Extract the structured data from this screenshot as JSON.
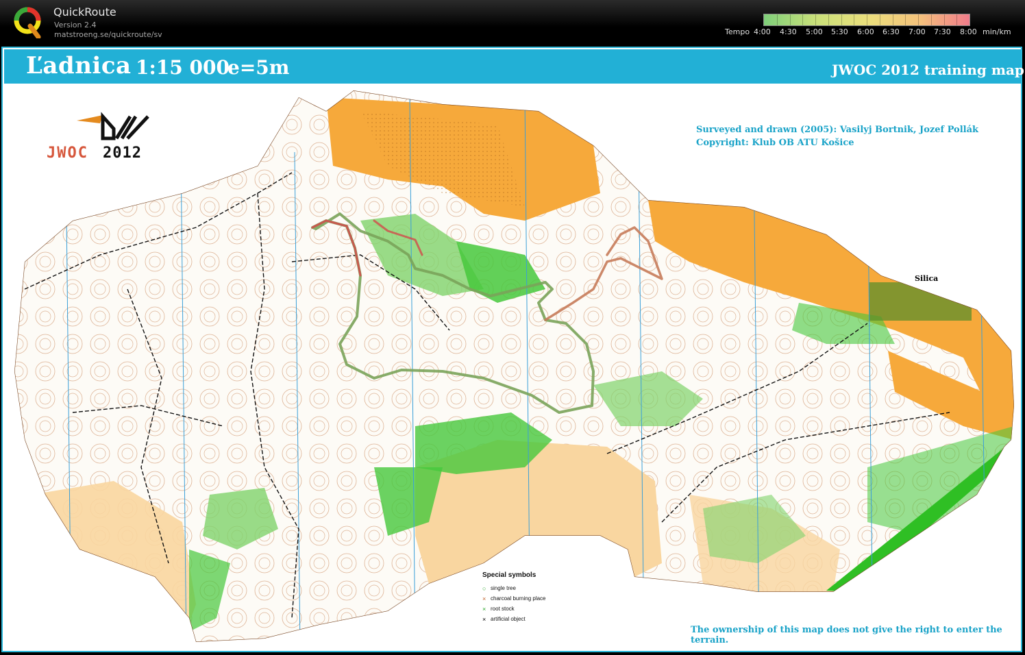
{
  "app": {
    "name": "QuickRoute",
    "version": "Version 2.4",
    "url": "matstroeng.se/quickroute/sv"
  },
  "tempo": {
    "label": "Tempo",
    "ticks": [
      "4:00",
      "4:30",
      "5:00",
      "5:30",
      "6:00",
      "6:30",
      "7:00",
      "7:30",
      "8:00"
    ],
    "unit": "min/km",
    "colors": [
      "#7fcf7a",
      "#c9e07a",
      "#eadf7c",
      "#f4c37c",
      "#f07c8a"
    ]
  },
  "map": {
    "title": "Ľadnica",
    "scale": "1:15 000",
    "contour": "e=5m",
    "subtitle": "JWOC 2012 training map",
    "credits_line1": "Surveyed and drawn (2005): Vasilyj Bortnik, Jozef Pollák",
    "credits_line2": "Copyright: Klub OB ATU Košice",
    "town": "Silica",
    "disclaimer": "The ownership of this map does not give the right to enter the terrain.",
    "logo_text": "JWOC2012",
    "colors": {
      "frame": "#22b0d6",
      "open_land": "#f6a93b",
      "rough_open": "#f9d6a0",
      "vegetation": "#46c83c",
      "contour": "#b4642d",
      "route_slow": "#d24a4a",
      "route_fast": "#7aa35a"
    }
  },
  "legend": {
    "title": "Special symbols",
    "items": [
      {
        "symbol": "○",
        "label": "single tree",
        "color": "#2fa82f"
      },
      {
        "symbol": "×",
        "label": "charcoal burning place",
        "color": "#c0622c"
      },
      {
        "symbol": "×",
        "label": "root stock",
        "color": "#2fa82f"
      },
      {
        "symbol": "×",
        "label": "artificial object",
        "color": "#000000"
      }
    ]
  }
}
